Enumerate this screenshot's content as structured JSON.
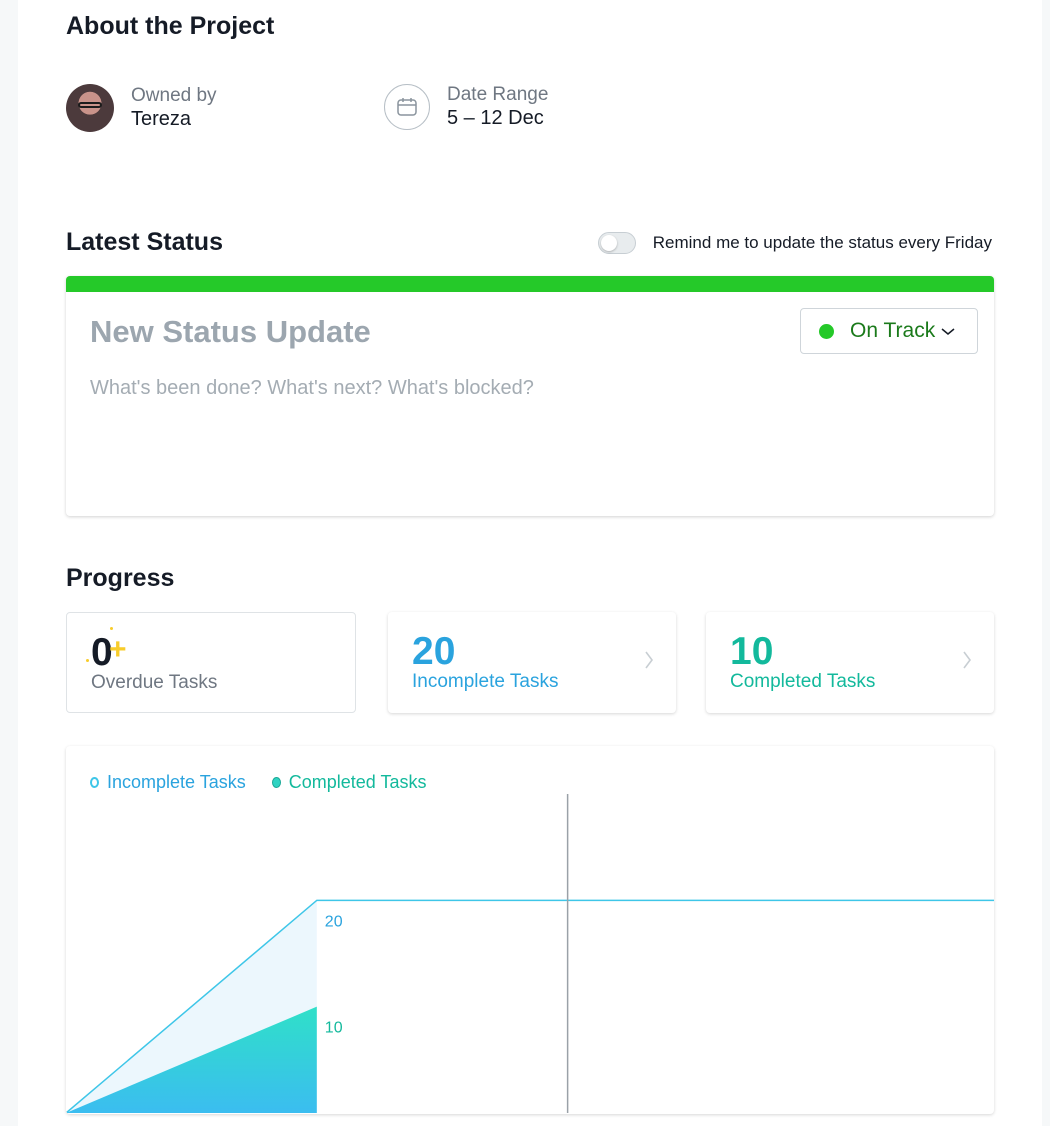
{
  "about": {
    "title": "About the Project",
    "owner_label": "Owned by",
    "owner_name": "Tereza",
    "date_label": "Date Range",
    "date_value": "5 – 12 Dec"
  },
  "status": {
    "title": "Latest Status",
    "remind_label": "Remind me to update the status every Friday",
    "remind_on": false,
    "card_title": "New Status Update",
    "card_prompt": "What's been done? What's next? What's blocked?",
    "state_label": "On Track",
    "state_color": "#25c929"
  },
  "progress": {
    "title": "Progress",
    "overdue_value": "0",
    "overdue_label": "Overdue Tasks",
    "incomplete_value": "20",
    "incomplete_label": "Incomplete Tasks",
    "completed_value": "10",
    "completed_label": "Completed Tasks"
  },
  "chart_data": {
    "type": "area",
    "legend": [
      "Incomplete Tasks",
      "Completed Tasks"
    ],
    "series": [
      {
        "name": "Incomplete Tasks",
        "color": "#3ec6e8",
        "points": [
          [
            0,
            0
          ],
          [
            1,
            20
          ],
          [
            3.7,
            20
          ]
        ]
      },
      {
        "name": "Completed Tasks",
        "color": "#2fd3c2",
        "points": [
          [
            0,
            0
          ],
          [
            1,
            10
          ]
        ]
      }
    ],
    "data_labels": [
      "20",
      "10"
    ],
    "today_marker_x": 2,
    "ylim": [
      0,
      30
    ],
    "xlim": [
      0,
      3.7
    ]
  }
}
